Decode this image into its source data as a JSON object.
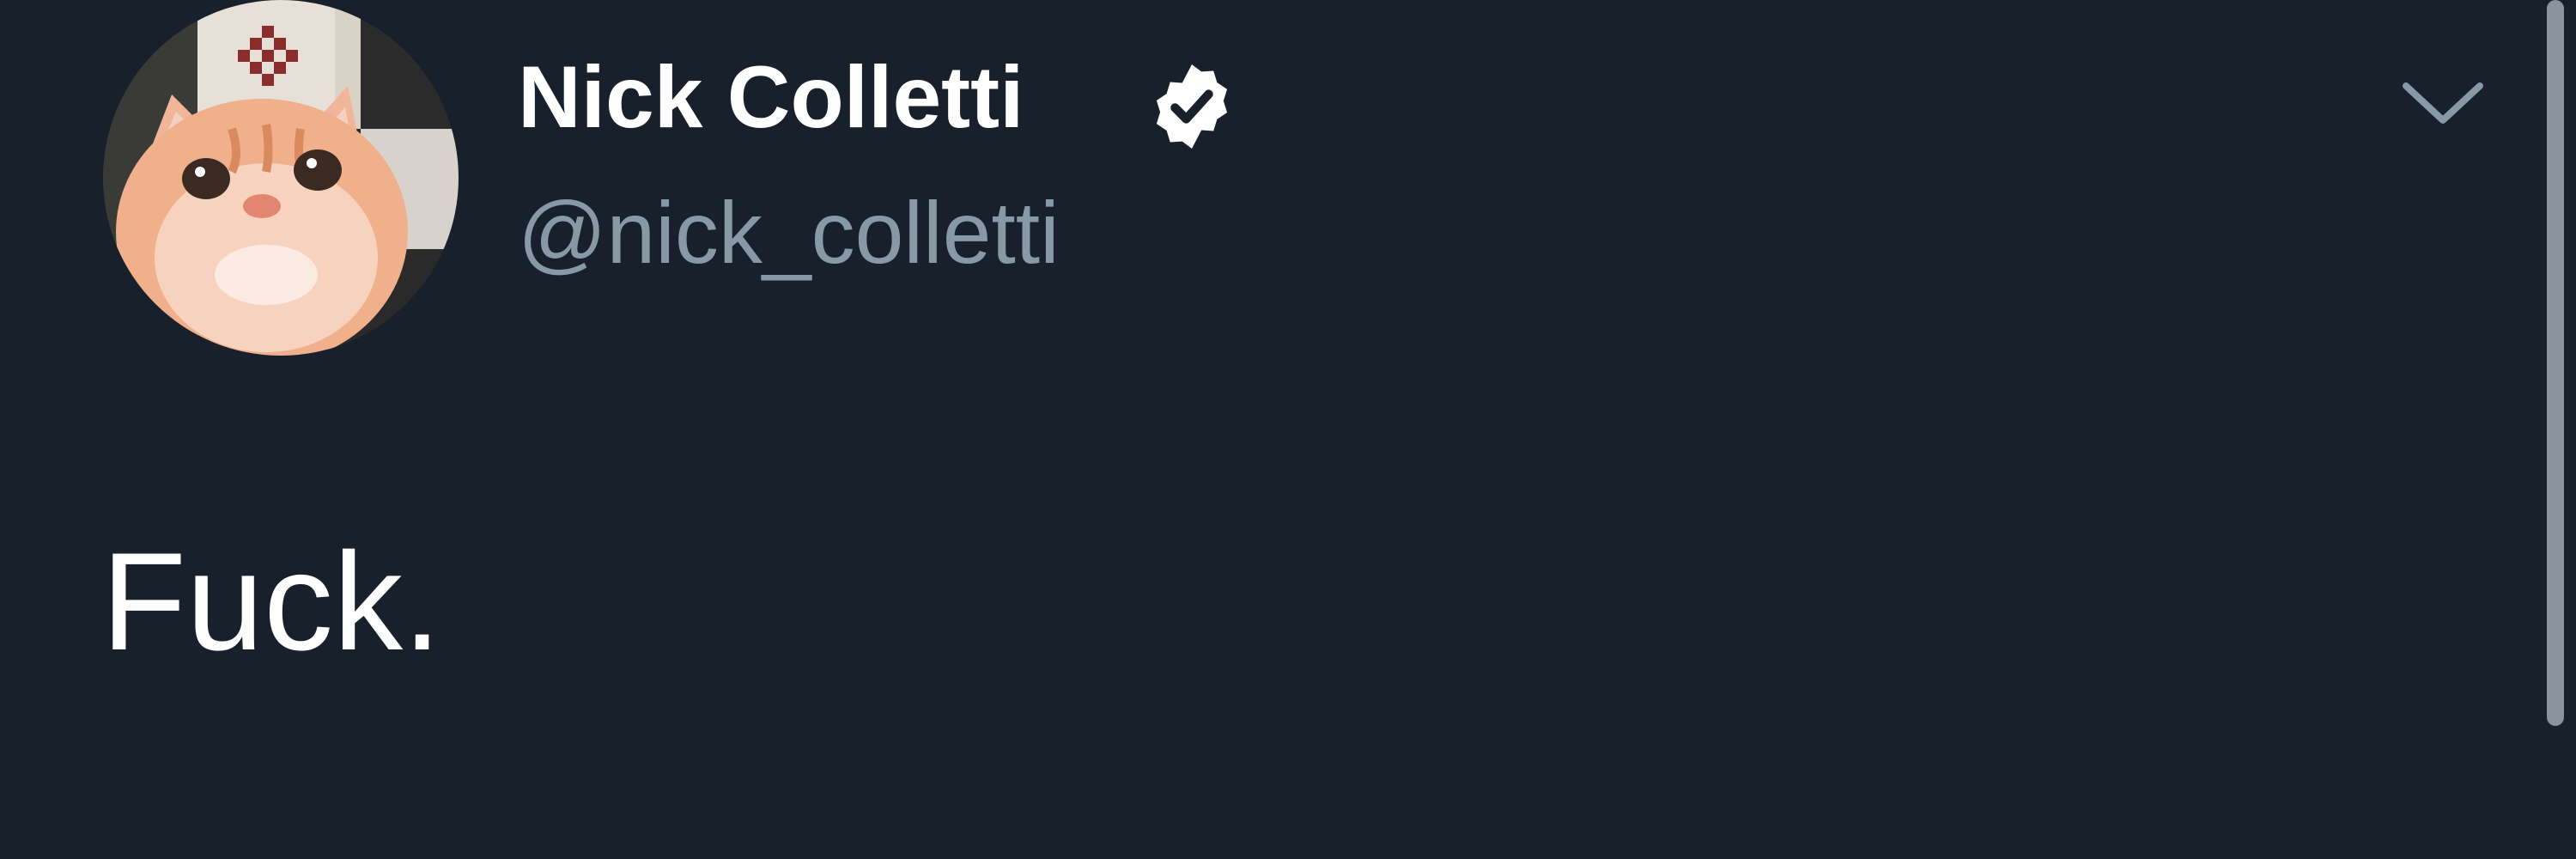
{
  "tweet": {
    "author": {
      "display_name": "Nick Colletti",
      "handle": "@nick_colletti",
      "verified": true,
      "avatar_icon": "cat-avatar"
    },
    "text": "Fuck.",
    "menu_icon": "chevron-down-icon"
  },
  "colors": {
    "background": "#18202b",
    "primary_text": "#ffffff",
    "secondary_text": "#8899a6",
    "chevron": "#8899a6"
  }
}
